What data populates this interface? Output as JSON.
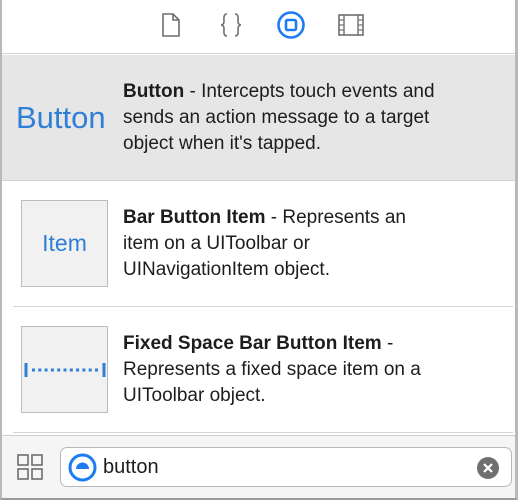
{
  "tabs": [
    {
      "icon": "file-icon",
      "selected": false
    },
    {
      "icon": "braces-icon",
      "selected": false
    },
    {
      "icon": "object-library-icon",
      "selected": true
    },
    {
      "icon": "media-library-icon",
      "selected": false
    }
  ],
  "items": [
    {
      "thumb_text": "Button",
      "name": "Button",
      "desc_line1": " - Intercepts touch events and",
      "desc_line2": "sends an action message to a target",
      "desc_line3": "object when it's tapped."
    },
    {
      "thumb_text": "Item",
      "name": "Bar Button Item",
      "desc_line1": " - Represents an",
      "desc_line2": "item on a UIToolbar or",
      "desc_line3": "UINavigationItem object."
    },
    {
      "thumb_text": "",
      "name": "Fixed Space Bar Button Item",
      "desc_line1": " -",
      "desc_line2": "Represents a fixed space item on a",
      "desc_line3": "UIToolbar object."
    }
  ],
  "filter": {
    "value": "button",
    "grid_icon": "grid-view-icon",
    "filter_icon": "filter-icon",
    "clear_icon": "clear-icon"
  },
  "colors": {
    "accent": "#2f7fd6",
    "selected_row": "#e6e6e6"
  }
}
